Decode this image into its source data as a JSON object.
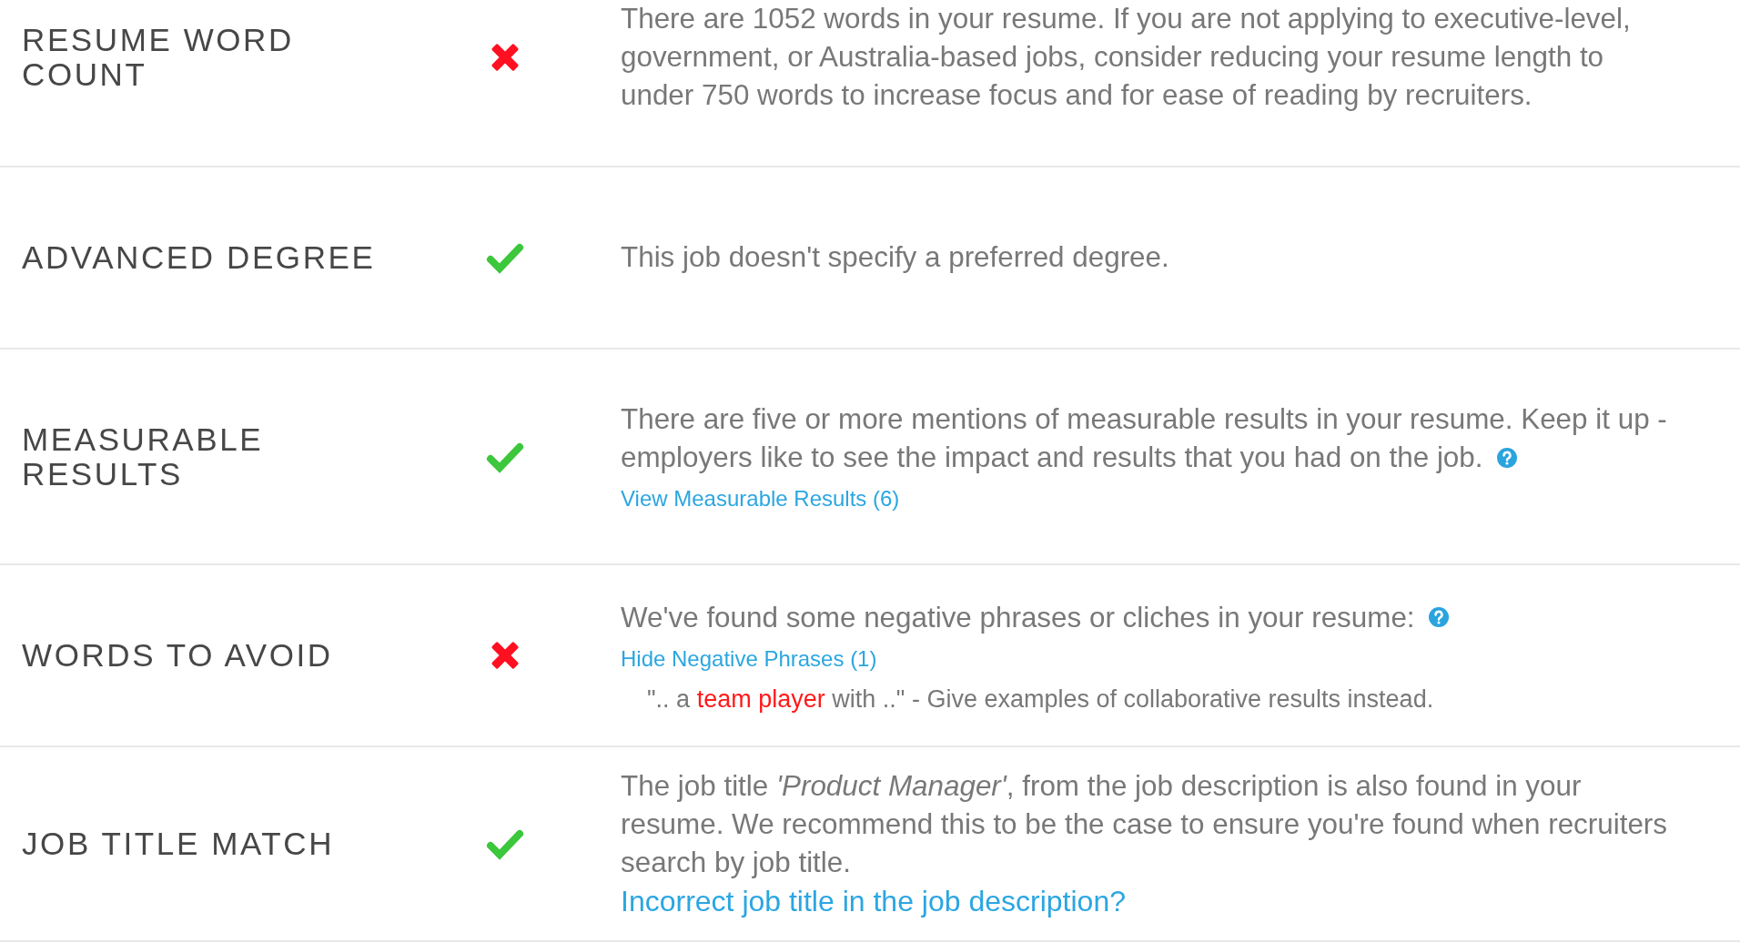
{
  "checks": [
    {
      "title": "RESUME WORD COUNT",
      "passed": false,
      "paragraph": "There are 1052 words in your resume. If you are not applying to executive-level, government, or Australia-based jobs, consider reducing your resume length to under 750 words to increase focus and for ease of reading by recruiters."
    },
    {
      "title": "ADVANCED DEGREE",
      "passed": true,
      "paragraph": "This job doesn't specify a preferred degree."
    },
    {
      "title": "MEASURABLE RESULTS",
      "passed": true,
      "help_icon": true,
      "paragraph": "There are five or more mentions of measurable results in your resume. Keep it up - employers like to see the impact and results that you had on the job.",
      "toggle": {
        "label": "View Measurable Results (6)"
      }
    },
    {
      "title": "WORDS TO AVOID",
      "passed": false,
      "help_icon": true,
      "paragraph": "We've found some negative phrases or cliches in your resume:",
      "toggle": {
        "label": "Hide Negative Phrases (1)"
      },
      "phrases": [
        {
          "before": "\".. a",
          "phrase": "team player",
          "after": "with ..\" - Give examples of collaborative results instead."
        }
      ]
    },
    {
      "title": "JOB TITLE MATCH",
      "passed": true,
      "paragraph": "The job title *'Product Manager'*, from the job description is also found in your resume. We recommend this to be the case to ensure you're found when recruiters search by job title.",
      "link": "Incorrect job title in the job description?"
    }
  ]
}
